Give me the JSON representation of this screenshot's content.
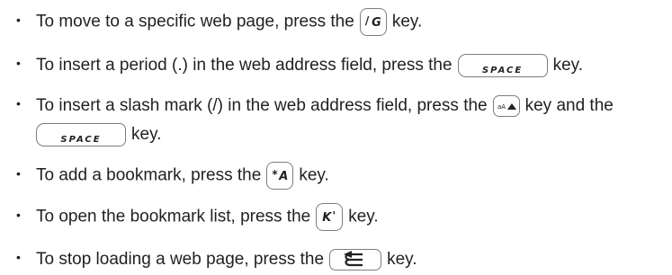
{
  "items": [
    {
      "before": "To move to a specific web page, press the",
      "key": {
        "top": "/",
        "bottom": "G"
      },
      "after": "key."
    },
    {
      "before": "To insert a period (.) in the web address field, press the",
      "key": {
        "label": "SPACE"
      },
      "after": "key."
    },
    {
      "before": "To insert a slash mark (/) in the web address field, press the",
      "key1": {
        "icon": "alt-key-icon"
      },
      "middle": "key and the",
      "key2": {
        "label": "SPACE"
      },
      "after": "key."
    },
    {
      "before": "To add a bookmark, press the",
      "key": {
        "top": "*",
        "bottom": "A"
      },
      "after": "key."
    },
    {
      "before": "To open the bookmark list, press the",
      "key": {
        "top": "'",
        "bottom": "K"
      },
      "after": "key."
    },
    {
      "before": "To stop loading a web page, press the",
      "key": {
        "icon": "back-arrow-icon"
      },
      "after": "key."
    }
  ]
}
